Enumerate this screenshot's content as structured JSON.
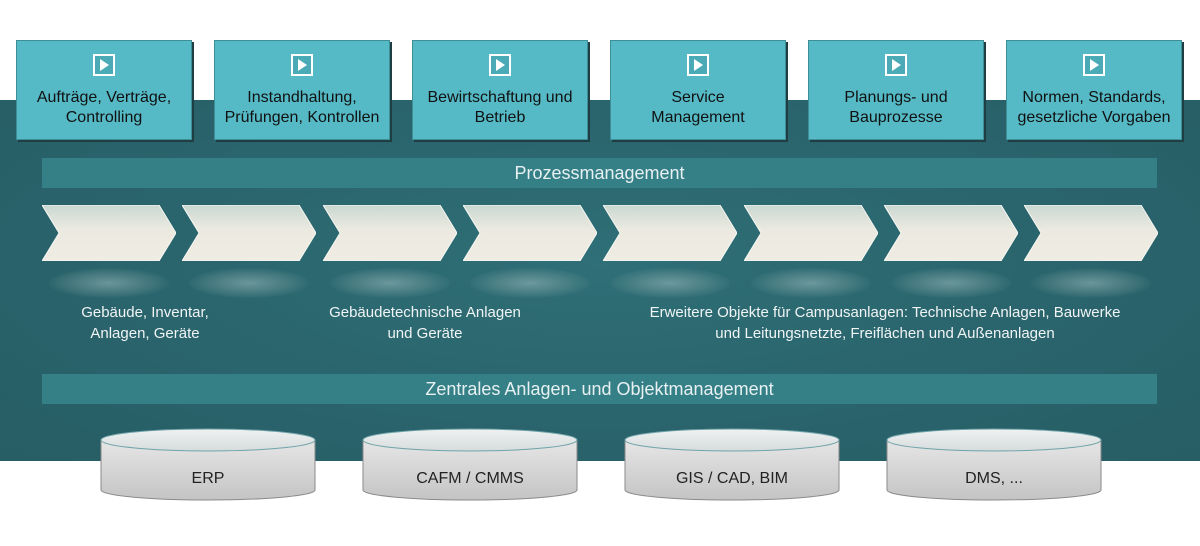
{
  "process_boxes": [
    {
      "icon": "play-icon",
      "label": "Aufträge, Verträge,\nControlling"
    },
    {
      "icon": "play-icon",
      "label": "Instandhaltung,\nPrüfungen, Kontrollen"
    },
    {
      "icon": "play-icon",
      "label": "Bewirtschaftung und\nBetrieb"
    },
    {
      "icon": "play-icon",
      "label": "Service\nManagement"
    },
    {
      "icon": "play-icon",
      "label": "Planungs- und\nBauprozesse"
    },
    {
      "icon": "play-icon",
      "label": "Normen, Standards,\ngesetzliche Vorgaben"
    }
  ],
  "process_bar": {
    "label": "Prozessmanagement"
  },
  "chevron_count": 8,
  "categories": [
    {
      "label": "Gebäude, Inventar,\nAnlagen, Geräte"
    },
    {
      "label": "Gebäudetechnische Anlagen\nund Geräte"
    },
    {
      "label": "Erweitere Objekte für Campusanlagen: Technische Anlagen, Bauwerke\nund Leitungsnetzte, Freiflächen und Außenanlagen"
    }
  ],
  "object_bar": {
    "label": "Zentrales Anlagen- und Objektmanagement"
  },
  "systems": [
    {
      "label": "ERP"
    },
    {
      "label": "CAFM / CMMS"
    },
    {
      "label": "GIS / CAD, BIM"
    },
    {
      "label": "DMS, ..."
    }
  ],
  "colors": {
    "band": "#2a646c",
    "box": "#55bac6",
    "bar": "#357f86",
    "chevron": "#eeece2",
    "cylinder": "#d4d4d4"
  }
}
